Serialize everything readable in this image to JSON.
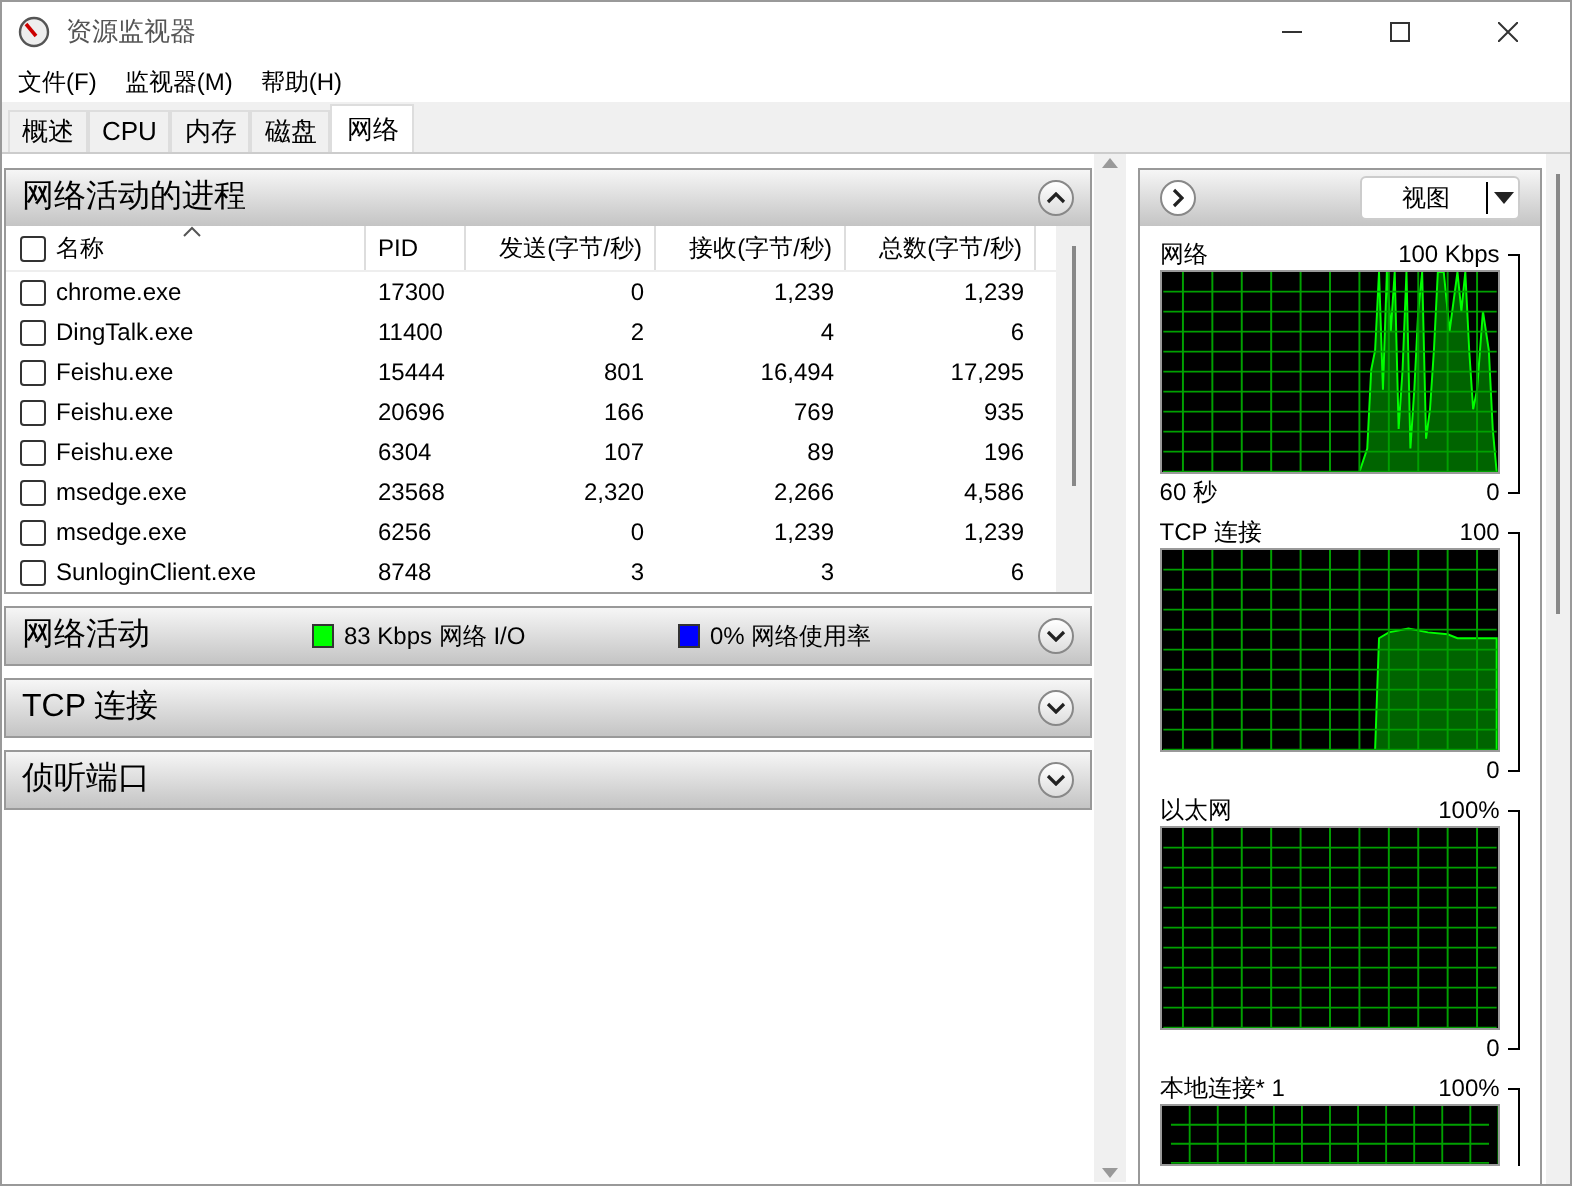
{
  "window": {
    "title": "资源监视器"
  },
  "menu": [
    "文件(F)",
    "监视器(M)",
    "帮助(H)"
  ],
  "tabs": [
    {
      "label": "概述",
      "selected": false
    },
    {
      "label": "CPU",
      "selected": false
    },
    {
      "label": "内存",
      "selected": false
    },
    {
      "label": "磁盘",
      "selected": false
    },
    {
      "label": "网络",
      "selected": true
    }
  ],
  "processes": {
    "title": "网络活动的进程",
    "expanded": true,
    "select_all_checked": false,
    "columns": [
      "名称",
      "PID",
      "发送(字节/秒)",
      "接收(字节/秒)",
      "总数(字节/秒)"
    ],
    "rows": [
      {
        "name": "chrome.exe",
        "pid": "17300",
        "send": "0",
        "receive": "1,239",
        "total": "1,239",
        "checked": false
      },
      {
        "name": "DingTalk.exe",
        "pid": "11400",
        "send": "2",
        "receive": "4",
        "total": "6",
        "checked": false
      },
      {
        "name": "Feishu.exe",
        "pid": "15444",
        "send": "801",
        "receive": "16,494",
        "total": "17,295",
        "checked": false
      },
      {
        "name": "Feishu.exe",
        "pid": "20696",
        "send": "166",
        "receive": "769",
        "total": "935",
        "checked": false
      },
      {
        "name": "Feishu.exe",
        "pid": "6304",
        "send": "107",
        "receive": "89",
        "total": "196",
        "checked": false
      },
      {
        "name": "msedge.exe",
        "pid": "23568",
        "send": "2,320",
        "receive": "2,266",
        "total": "4,586",
        "checked": false
      },
      {
        "name": "msedge.exe",
        "pid": "6256",
        "send": "0",
        "receive": "1,239",
        "total": "1,239",
        "checked": false
      },
      {
        "name": "SunloginClient.exe",
        "pid": "8748",
        "send": "3",
        "receive": "3",
        "total": "6",
        "checked": false
      }
    ]
  },
  "sections": [
    {
      "title": "网络活动",
      "expanded": false,
      "legend": [
        {
          "text": "83 Kbps 网络 I/O",
          "color": "#00ff00"
        },
        {
          "text": "0% 网络使用率",
          "color": "#0000ff"
        }
      ]
    },
    {
      "title": "TCP 连接",
      "expanded": false
    },
    {
      "title": "侦听端口",
      "expanded": false
    }
  ],
  "side_panel": {
    "view_button": "视图",
    "graphs": [
      {
        "title": "网络",
        "max": "100 Kbps",
        "time": "60 秒",
        "min": "0",
        "kind": "spiky"
      },
      {
        "title": "TCP 连接",
        "max": "100",
        "min": "0",
        "kind": "plateau"
      },
      {
        "title": "以太网",
        "max": "100%",
        "min": "0",
        "kind": "empty"
      },
      {
        "title": "本地连接* 1",
        "max": "100%",
        "kind": "empty"
      }
    ]
  }
}
